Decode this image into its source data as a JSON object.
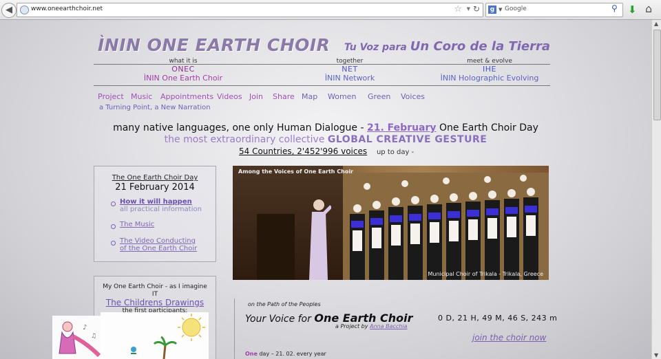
{
  "browser": {
    "url": "www.oneearthchoir.net",
    "search_placeholder": "Google"
  },
  "header": {
    "title": "ÌNIN ONE EARTH CHOIR",
    "tagline_prefix": "Tu Voz para",
    "tagline_main": "Un Coro de la Tierra",
    "columns": [
      {
        "small": "what it is",
        "code": "ONEC",
        "name": "ÌNIN One Earth Choir"
      },
      {
        "small": "together",
        "code": "NET",
        "name": "ÌNIN Network"
      },
      {
        "small": "meet & evolve",
        "code": "IHE",
        "name": "ÌNIN Holographic Evolving"
      }
    ]
  },
  "menu": {
    "items": [
      "Project",
      "Music",
      "Appointments",
      "Videos",
      "Join",
      "Share",
      "Map",
      "Women",
      "Green",
      "Voices"
    ],
    "sub": "a Turning Point, a New Narration"
  },
  "intro": {
    "line1_pre": "many native languages, one only Human Dialogue -",
    "line1_date": "21. February",
    "line1_post": "One Earth Choir Day",
    "line2_pre": "the most extraordinary collective",
    "line2_bold": "GLOBAL CREATIVE GESTURE",
    "line3_counts": "54 Countries,  2'452'996  voices",
    "line3_suffix": "up to day -"
  },
  "day_box": {
    "title": "The One Earth Choir Day",
    "date": "21 February 2014",
    "links": [
      {
        "label": "How it will happen",
        "sub": "all practical information"
      },
      {
        "label": "The Music",
        "sub": ""
      },
      {
        "label": "The Video Conducting",
        "sub": "of the One Earth Choir"
      }
    ]
  },
  "imagine_box": {
    "line1": "My One Earth Choir - as I imagine",
    "line2": "IT",
    "link": "The Childrens Drawings",
    "sub": "the first participants:"
  },
  "photo": {
    "caption_top": "Among the Voices of One Earth Choir",
    "caption_bottom": "Municipal Choir of Trikala - Trikala, Greece"
  },
  "lower": {
    "path": "on the Path of the Peoples",
    "your_voice_pre": "Your Voice for",
    "your_voice_bold": "One Earth Choir",
    "project_pre": "a Project by",
    "project_author": "Anna Bacchia",
    "countdown": "0 D, 21 H, 49 M, 46 S, 243 m",
    "join": "join the choir now",
    "oneday_bold": "One",
    "oneday_rest": "day – 21. 02. every year"
  }
}
